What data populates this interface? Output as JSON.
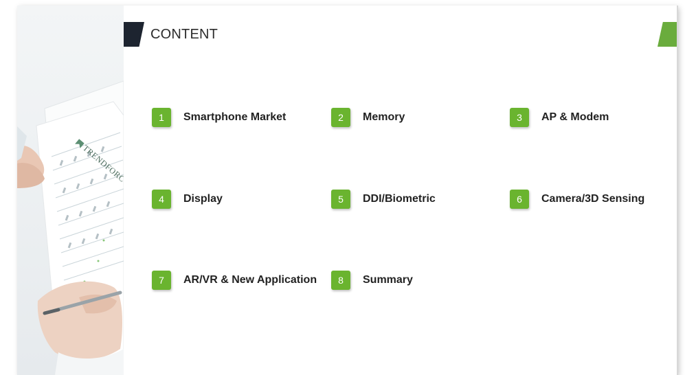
{
  "header": {
    "title": "CONTENT"
  },
  "brand": {
    "text": "TRENDFORC"
  },
  "agenda": [
    {
      "num": "1",
      "label": "Smartphone Market"
    },
    {
      "num": "2",
      "label": "Memory"
    },
    {
      "num": "3",
      "label": "AP & Modem"
    },
    {
      "num": "4",
      "label": "Display"
    },
    {
      "num": "5",
      "label": "DDI/Biometric"
    },
    {
      "num": "6",
      "label": "Camera/3D Sensing"
    },
    {
      "num": "7",
      "label": "AR/VR & New Application"
    },
    {
      "num": "8",
      "label": "Summary"
    }
  ],
  "colors": {
    "accent_green": "#6ab42f",
    "header_dark": "#1d2430"
  }
}
